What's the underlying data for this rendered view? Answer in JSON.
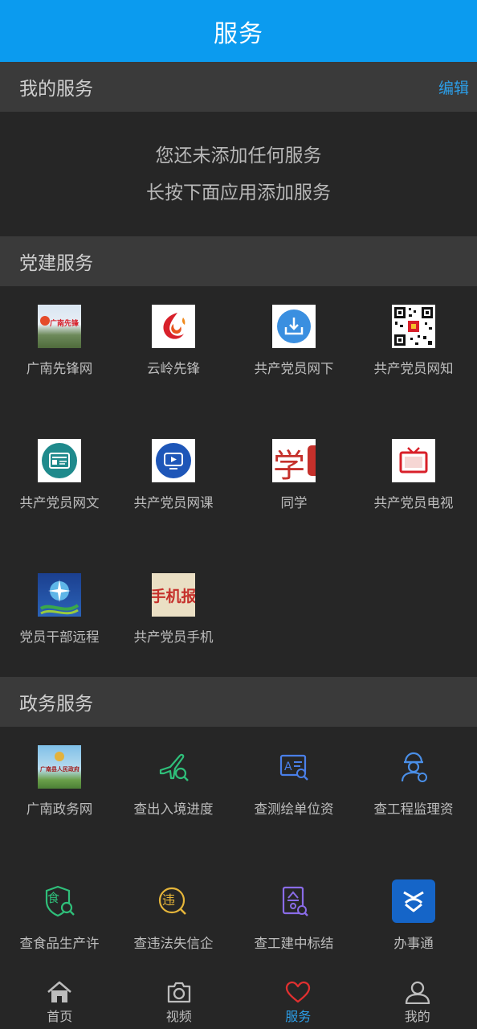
{
  "header": {
    "title": "服务"
  },
  "my_services": {
    "title": "我的服务",
    "edit_label": "编辑",
    "empty_line1": "您还未添加任何服务",
    "empty_line2": "长按下面应用添加服务"
  },
  "party_services": {
    "title": "党建服务",
    "items": [
      {
        "label": "广南先锋网",
        "icon": "guangnan-pioneer-logo",
        "logo_text": "广南先锋"
      },
      {
        "label": "云岭先锋",
        "icon": "yunling-pioneer-logo"
      },
      {
        "label": "共产党员网下",
        "icon": "download-tray-icon"
      },
      {
        "label": "共产党员网知",
        "icon": "qr-code-icon"
      },
      {
        "label": "共产党员网文",
        "icon": "article-icon"
      },
      {
        "label": "共产党员网课",
        "icon": "video-course-icon"
      },
      {
        "label": "同学",
        "icon": "study-logo",
        "logo_text": "学"
      },
      {
        "label": "共产党员电视",
        "icon": "tv-icon"
      },
      {
        "label": "党员干部远程",
        "icon": "remote-education-icon"
      },
      {
        "label": "共产党员手机",
        "icon": "mobile-newspaper-logo",
        "logo_text": "手机报"
      }
    ]
  },
  "gov_services": {
    "title": "政务服务",
    "items": [
      {
        "label": "广南政务网",
        "icon": "gov-portal-logo",
        "logo_text": "广南县人民政府"
      },
      {
        "label": "查出入境进度",
        "icon": "airplane-search-icon"
      },
      {
        "label": "查测绘单位资",
        "icon": "survey-search-icon"
      },
      {
        "label": "查工程监理资",
        "icon": "engineer-icon"
      },
      {
        "label": "查食品生产许",
        "icon": "food-shield-icon",
        "logo_text": "食"
      },
      {
        "label": "查违法失信企",
        "icon": "violation-search-icon",
        "logo_text": "违"
      },
      {
        "label": "查工建中标结",
        "icon": "bid-document-icon"
      },
      {
        "label": "办事通",
        "icon": "banshitong-logo"
      }
    ]
  },
  "bottom_nav": [
    {
      "label": "首页",
      "icon": "home-icon"
    },
    {
      "label": "视频",
      "icon": "camera-icon"
    },
    {
      "label": "服务",
      "icon": "heart-icon",
      "active": true
    },
    {
      "label": "我的",
      "icon": "user-icon"
    }
  ],
  "colors": {
    "accent": "#0b9bef",
    "nav_active": "#e03030",
    "background": "#262626",
    "section_header": "#3a3a3a"
  }
}
